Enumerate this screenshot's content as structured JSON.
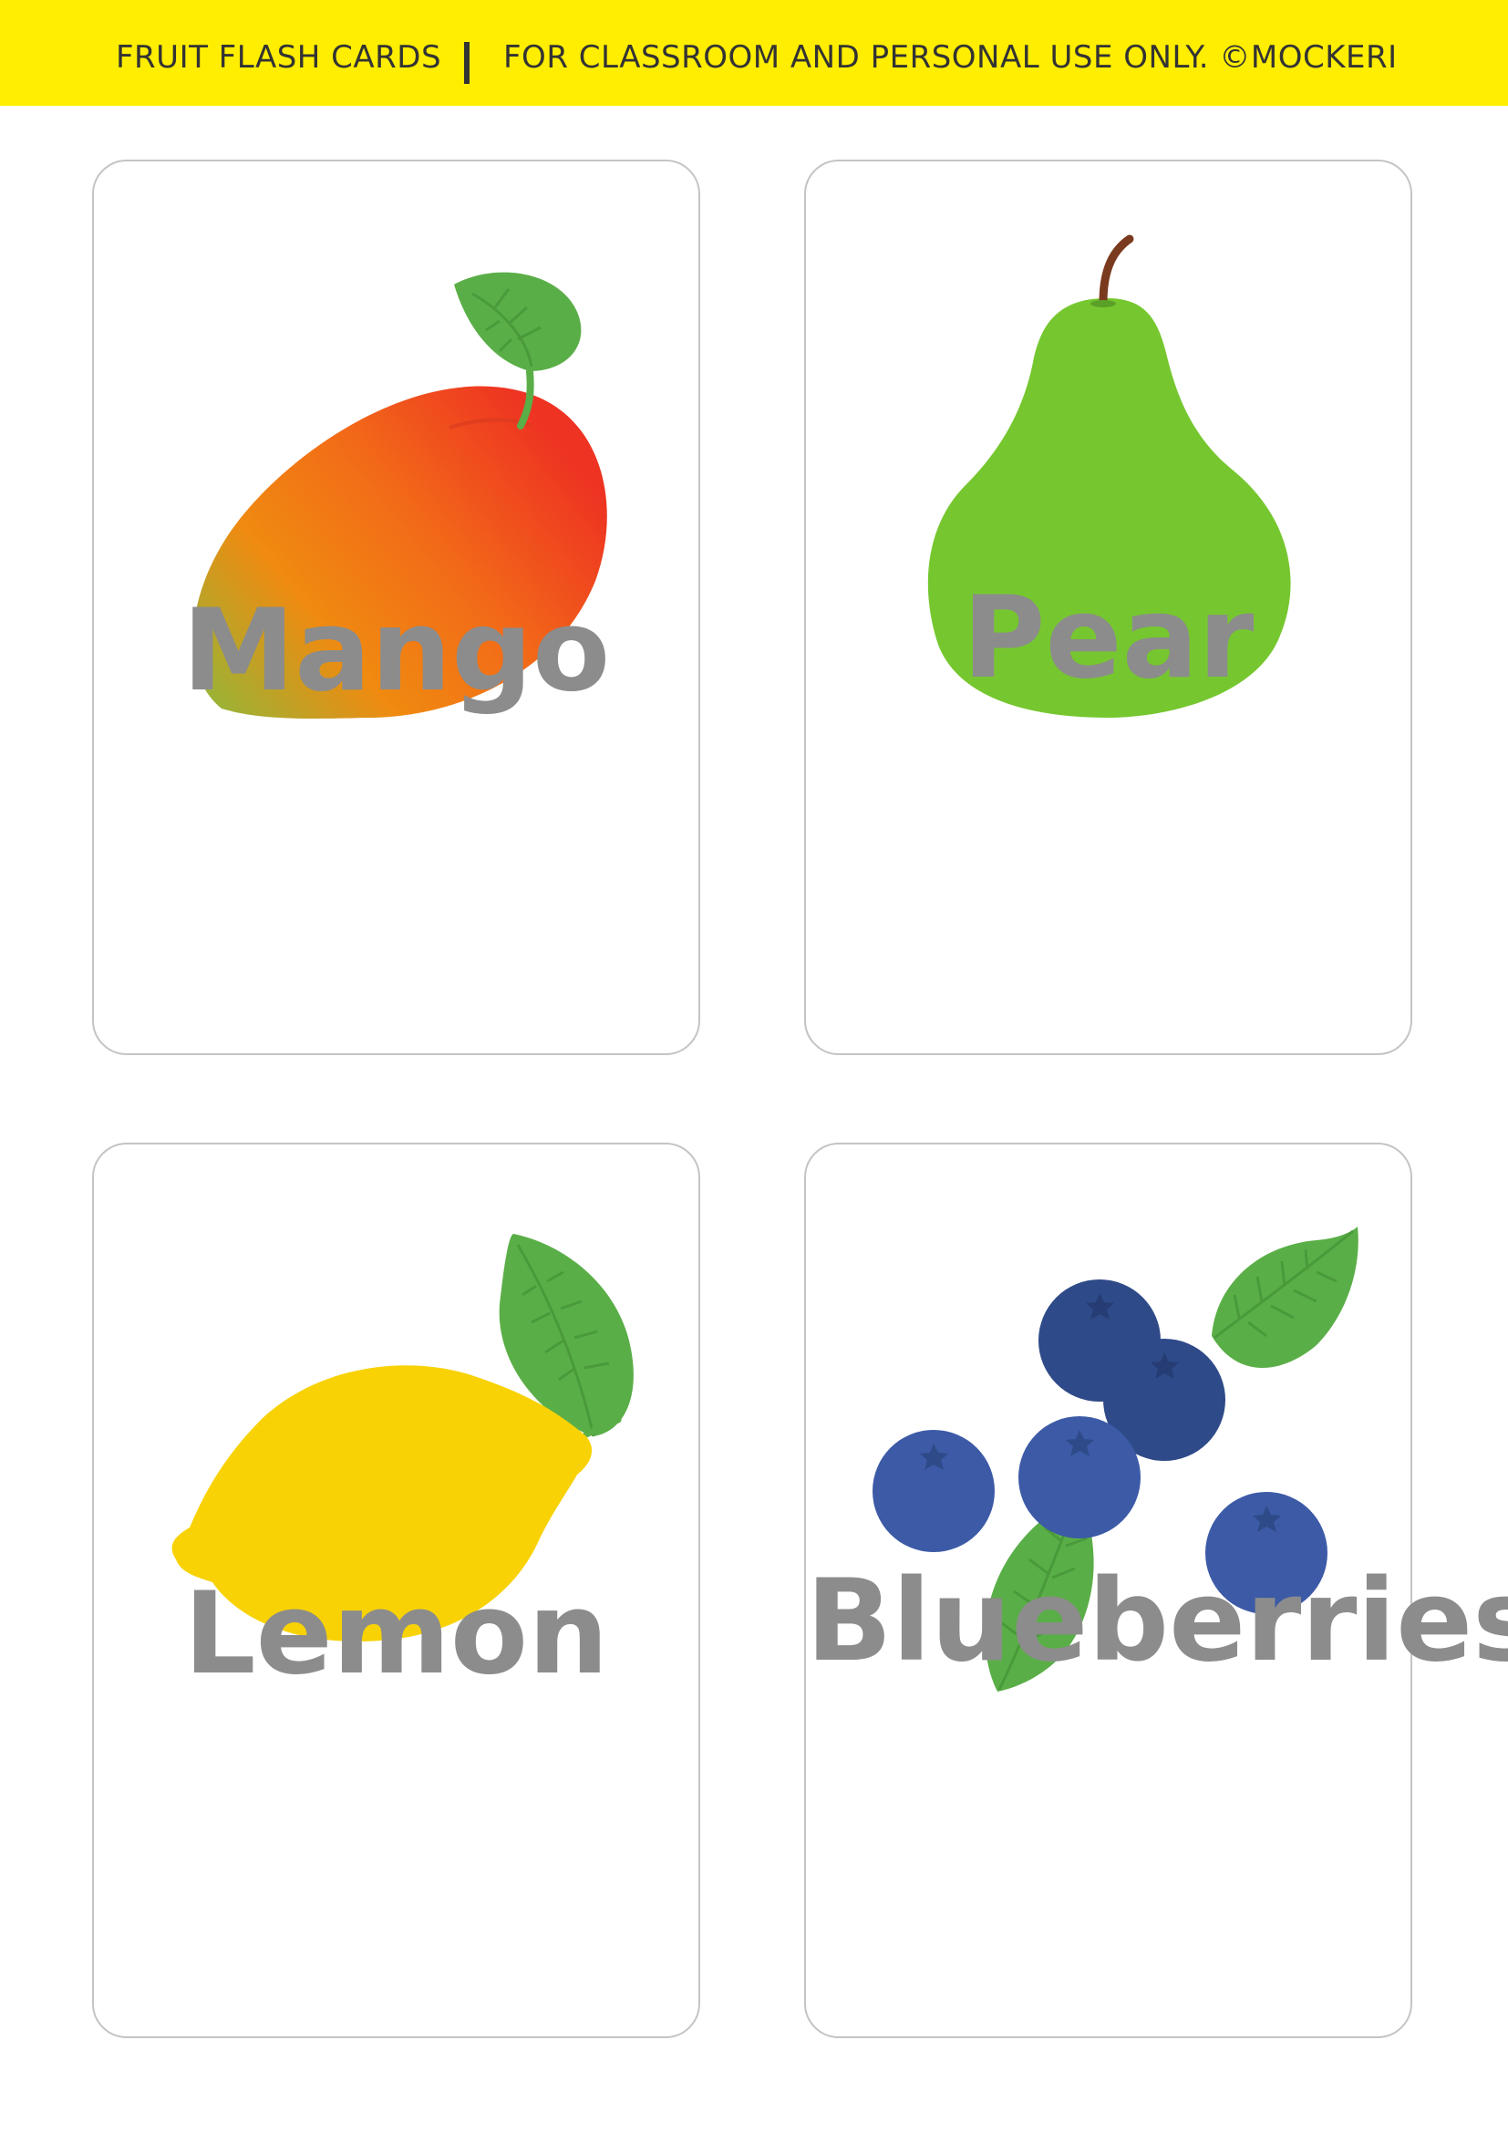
{
  "header": {
    "title": "FRUIT FLASH CARDS",
    "notice": "FOR CLASSROOM AND PERSONAL USE ONLY. ©MOCKERI",
    "background_color": "#ffee00"
  },
  "cards": [
    {
      "label": "Mango",
      "icon": "mango-icon"
    },
    {
      "label": "Pear",
      "icon": "pear-icon"
    },
    {
      "label": "Lemon",
      "icon": "lemon-icon"
    },
    {
      "label": "Blueberries",
      "icon": "blueberries-icon"
    }
  ],
  "colors": {
    "label_text": "#8c8c8c",
    "card_border": "#c4c4c4",
    "leaf_green": "#5aae47",
    "pear_green": "#76c72f",
    "lemon_yellow": "#f8d205",
    "blueberry_blue": "#3c5aa6"
  }
}
